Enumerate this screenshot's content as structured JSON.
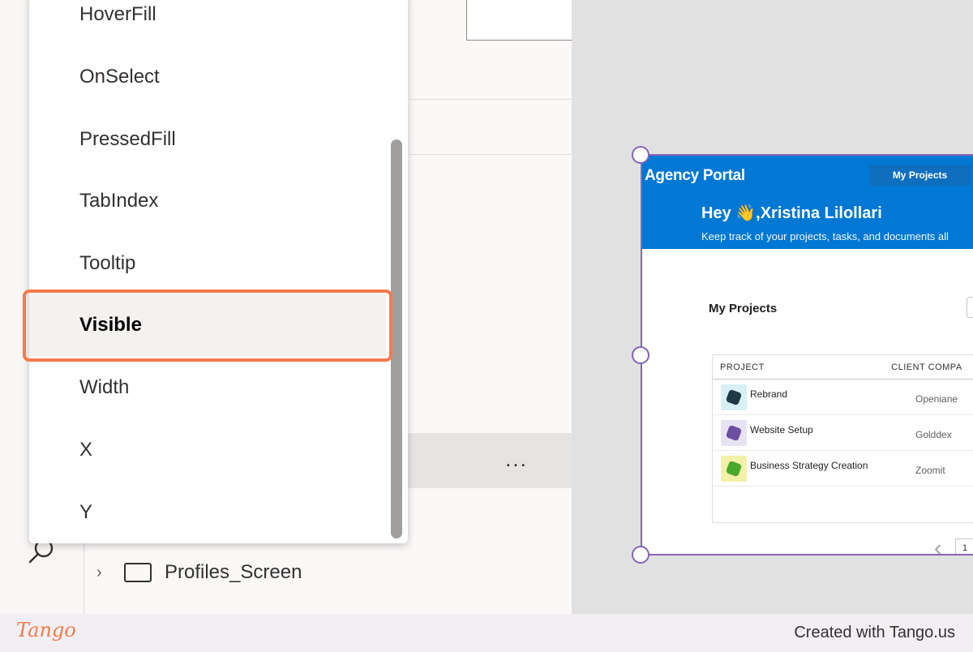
{
  "dropdown": {
    "items": [
      {
        "label": "HoverFill"
      },
      {
        "label": "OnSelect"
      },
      {
        "label": "PressedFill"
      },
      {
        "label": "TabIndex"
      },
      {
        "label": "Tooltip"
      },
      {
        "label": "Visible",
        "selected": true
      },
      {
        "label": "Width"
      },
      {
        "label": "X"
      },
      {
        "label": "Y"
      }
    ]
  },
  "tree": {
    "more_label": "...",
    "screen_item": {
      "label": "Profiles_Screen",
      "icon": "screen-icon"
    }
  },
  "app_preview": {
    "brand": "Agency Portal",
    "nav_tab": "My Projects",
    "greeting": "Hey 👋,Xristina Lilollari",
    "subtext": "Keep track of your projects, tasks, and documents all",
    "section_title": "My Projects",
    "table": {
      "headers": [
        "PROJECT",
        "CLIENT COMPA"
      ],
      "rows": [
        {
          "project": "Rebrand",
          "client": "Openiane",
          "logo_bg": "#d7f0f5",
          "logo_fg": "#1f3a44"
        },
        {
          "project": "Website Setup",
          "client": "Golddex",
          "logo_bg": "#e8e3f2",
          "logo_fg": "#6b4fa0"
        },
        {
          "project": "Business Strategy Creation",
          "client": "Zoomit",
          "logo_bg": "#f3f0a8",
          "logo_fg": "#4ba82e"
        }
      ]
    },
    "pager": {
      "prev": "‹",
      "page": "1"
    }
  },
  "footer": {
    "logo": "Tango",
    "credit": "Created with Tango.us"
  },
  "colors": {
    "highlight": "#f47b4a",
    "selection": "#8764b8",
    "header_blue": "#0078d4"
  }
}
